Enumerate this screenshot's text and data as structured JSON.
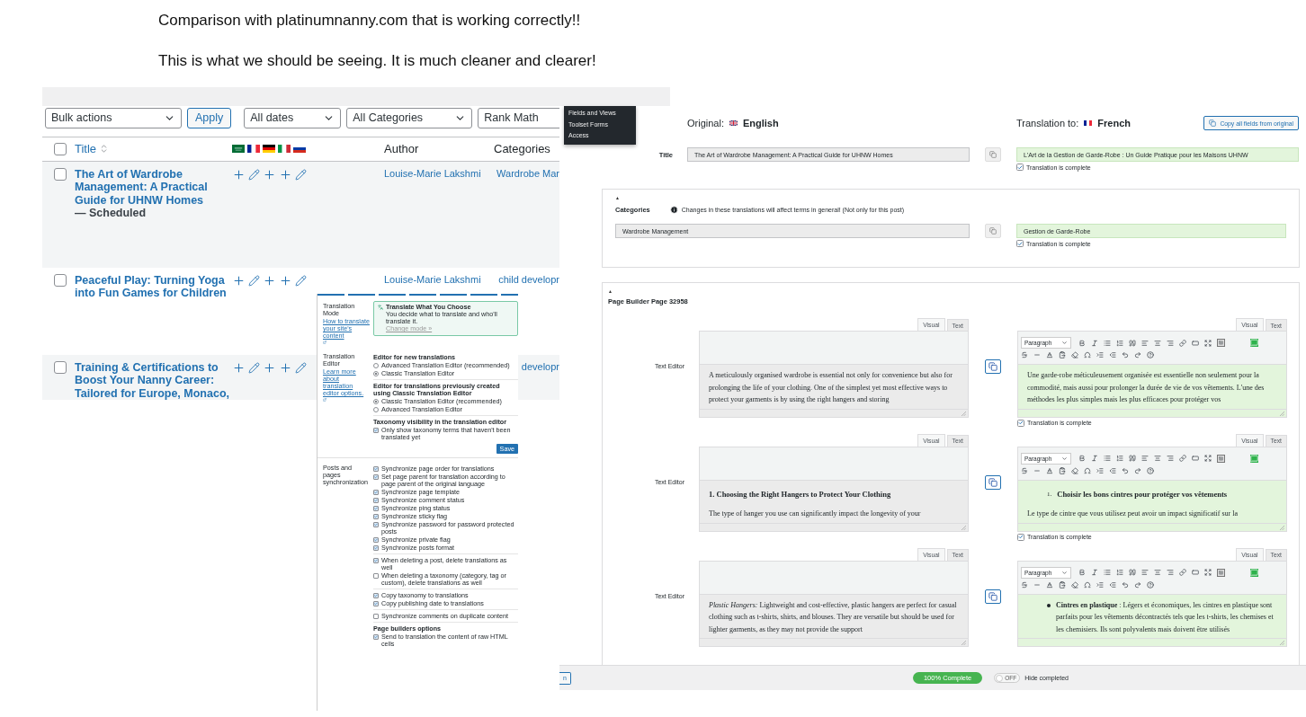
{
  "heading": {
    "lines": [
      "Comparison with platinumnanny.com that is working correctly!!",
      "This is what we should be seeing. It is much cleaner and clearer!"
    ]
  },
  "posts_list": {
    "toolbar": {
      "bulk_actions": "Bulk actions",
      "apply": "Apply",
      "dates": "All dates",
      "categories": "All Categories",
      "seo": "Rank Math"
    },
    "columns": {
      "title": "Title",
      "author": "Author",
      "categories": "Categories"
    },
    "select_all_checked": false,
    "rows": [
      {
        "title": "The Art of Wardrobe Management: A Practical Guide for UHNW Homes",
        "status": "— Scheduled",
        "author": "Louise-Marie Lakshmi",
        "category": "Wardrobe Mar",
        "checked": false,
        "translations": [
          {
            "kind": "add"
          },
          {
            "kind": "edit"
          },
          {
            "kind": "add"
          },
          {
            "kind": "add"
          },
          {
            "kind": "edit"
          }
        ]
      },
      {
        "title": "Peaceful Play: Turning Yoga into Fun Games for Children",
        "author": "Louise-Marie Lakshmi",
        "category": "child developr",
        "checked": false,
        "translations": [
          {
            "kind": "add"
          },
          {
            "kind": "edit"
          },
          {
            "kind": "add"
          },
          {
            "kind": "add"
          },
          {
            "kind": "edit"
          }
        ]
      },
      {
        "title": "Training & Certifications to Boost Your Nanny Career: Tailored for Europe, Monaco,",
        "category": "developr",
        "checked": false,
        "translations": [
          {
            "kind": "add"
          },
          {
            "kind": "edit"
          },
          {
            "kind": "add"
          },
          {
            "kind": "add"
          },
          {
            "kind": "edit"
          }
        ]
      }
    ]
  },
  "menu": {
    "items": [
      "Fields and Views",
      "Toolset Forms",
      "Access"
    ]
  },
  "settings": {
    "mode": {
      "label": "Translation Mode",
      "link": "How to translate your site's content",
      "card_title": "Translate What You Choose",
      "card_text": "You decide what to translate and who'll translate it.",
      "card_link": "Change mode »"
    },
    "editor": {
      "label": "Translation Editor",
      "link": "Learn more about translation editor options.",
      "save": "Save",
      "groups": [
        {
          "heading": "Editor for new translations",
          "items": [
            {
              "kind": "radio",
              "label": "Advanced Translation Editor (recommended)",
              "selected": false
            },
            {
              "kind": "radio",
              "label": "Classic Translation Editor",
              "selected": true
            }
          ]
        },
        {
          "heading": "Editor for translations previously created using Classic Translation Editor",
          "items": [
            {
              "kind": "radio",
              "label": "Classic Translation Editor (recommended)",
              "selected": true
            },
            {
              "kind": "radio",
              "label": "Advanced Translation Editor",
              "selected": false
            }
          ]
        },
        {
          "heading": "Taxonomy visibility in the translation editor",
          "items": [
            {
              "kind": "checkbox",
              "label": "Only show taxonomy terms that haven't been translated yet",
              "checked": true
            }
          ]
        }
      ]
    },
    "sync": {
      "label": "Posts and pages synchronization",
      "groups": [
        {
          "items": [
            {
              "kind": "checkbox",
              "label": "Synchronize page order for translations",
              "checked": true
            },
            {
              "kind": "checkbox",
              "label": "Set page parent for translation according to page parent of the original language",
              "checked": true
            },
            {
              "kind": "checkbox",
              "label": "Synchronize page template",
              "checked": true
            },
            {
              "kind": "checkbox",
              "label": "Synchronize comment status",
              "checked": true
            },
            {
              "kind": "checkbox",
              "label": "Synchronize ping status",
              "checked": true
            },
            {
              "kind": "checkbox",
              "label": "Synchronize sticky flag",
              "checked": true
            },
            {
              "kind": "checkbox",
              "label": "Synchronize password for password protected posts",
              "checked": true
            },
            {
              "kind": "checkbox",
              "label": "Synchronize private flag",
              "checked": true
            },
            {
              "kind": "checkbox",
              "label": "Synchronize posts format",
              "checked": true
            }
          ]
        },
        {
          "items": [
            {
              "kind": "checkbox",
              "label": "When deleting a post, delete translations as well",
              "checked": true
            },
            {
              "kind": "checkbox",
              "label": "When deleting a taxonomy (category, tag or custom), delete translations as well",
              "checked": false
            }
          ]
        },
        {
          "items": [
            {
              "kind": "checkbox",
              "label": "Copy taxonomy to translations",
              "checked": true
            },
            {
              "kind": "checkbox",
              "label": "Copy publishing date to translations",
              "checked": true
            }
          ]
        },
        {
          "items": [
            {
              "kind": "checkbox",
              "label": "Synchronize comments on duplicate content",
              "checked": false
            }
          ]
        },
        {
          "heading": "Page builders options",
          "items": [
            {
              "kind": "checkbox",
              "label": "Send to translation the content of raw HTML cells",
              "checked": true
            }
          ]
        }
      ]
    }
  },
  "translation_editor": {
    "original_label": "Original:",
    "original_language": "English",
    "translation_label": "Translation to:",
    "translation_language": "French",
    "copy_all": "Copy all fields from original",
    "title": {
      "label": "Title",
      "original": "The Art of Wardrobe Management: A Practical Guide for UHNW Homes",
      "translation": "L'Art de la Gestion de Garde-Robe : Un Guide Pratique pour les Maisons UHNW",
      "complete": true,
      "complete_label": "Translation is complete"
    },
    "categories": {
      "toggle": "▲",
      "label": "Categories",
      "notice": "Changes in these translations will affect terms in general! (Not only for this post)",
      "original": "Wardrobe Management",
      "translation": "Gestion de Garde-Robe",
      "complete": true,
      "complete_label": "Translation is complete"
    },
    "page_builder": {
      "toggle": "▲",
      "title": "Page Builder Page 32958",
      "rows": [
        {
          "label": "Text Editor",
          "original_tabs": [
            {
              "label": "Visual",
              "selected": true
            },
            {
              "label": "Text",
              "selected": false
            }
          ],
          "translation_tabs": [
            {
              "label": "Visual",
              "selected": true
            },
            {
              "label": "Text",
              "selected": false
            }
          ],
          "format": "Paragraph",
          "complete": true,
          "complete_label": "Translation is complete",
          "original": [
            {
              "kind": "paragraph",
              "text": "A meticulously organised wardrobe is essential not only for convenience but also for prolonging the life of your clothing. One of the simplest yet most effective ways to protect your garments is by using the right hangers and storing"
            }
          ],
          "translation": [
            {
              "kind": "paragraph",
              "text": "Une garde-robe méticuleusement organisée est essentielle non seulement pour la commodité, mais aussi pour prolonger la durée de vie de vos vêtements. L'une des méthodes les plus simples mais les plus efficaces pour protéger vos"
            }
          ]
        },
        {
          "label": "Text Editor",
          "original_tabs": [
            {
              "label": "Visual",
              "selected": true
            },
            {
              "label": "Text",
              "selected": false
            }
          ],
          "translation_tabs": [
            {
              "label": "Visual",
              "selected": true
            },
            {
              "label": "Text",
              "selected": false
            }
          ],
          "format": "Paragraph",
          "complete": true,
          "complete_label": "Translation is complete",
          "original": [
            {
              "kind": "heading",
              "text": "1. Choosing the Right Hangers to Protect Your Clothing"
            },
            {
              "kind": "paragraph",
              "text": "The type of hanger you use can significantly impact the longevity of your"
            }
          ],
          "translation": [
            {
              "kind": "numbered",
              "marker": "1.",
              "text": "Choisir les bons cintres pour protéger vos vêtements"
            },
            {
              "kind": "paragraph",
              "text": "Le type de cintre que vous utilisez peut avoir un impact significatif sur la"
            }
          ]
        },
        {
          "label": "Text Editor",
          "original_tabs": [
            {
              "label": "Visual",
              "selected": true
            },
            {
              "label": "Text",
              "selected": false
            }
          ],
          "translation_tabs": [
            {
              "label": "Visual",
              "selected": true
            },
            {
              "label": "Text",
              "selected": false
            }
          ],
          "format": "Paragraph",
          "original": [
            {
              "kind": "paragraph",
              "text": "*Plastic Hangers:* Lightweight and cost-effective, plastic hangers are perfect for casual clothing such as t-shirts, shirts, and blouses. They are versatile but should be used for lighter garments, as they may not provide the support"
            }
          ],
          "translation": [
            {
              "kind": "bullet",
              "text": "**Cintres en plastique** : Légers et économiques, les cintres en plastique sont parfaits pour les vêtements décontractés tels que les t-shirts, les chemises et les chemisiers. Ils sont polyvalents mais doivent être utilisés"
            }
          ]
        }
      ]
    },
    "footer": {
      "fragment": "n",
      "progress": "100% Complete",
      "toggle_label": "OFF",
      "hide_completed": false,
      "hide_label": "Hide completed"
    }
  }
}
